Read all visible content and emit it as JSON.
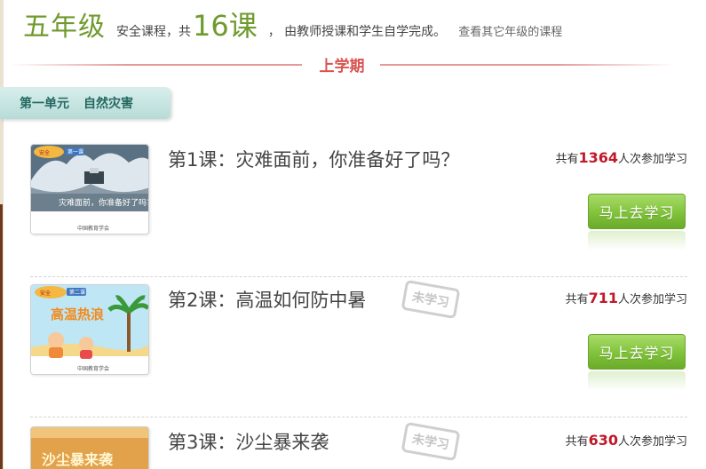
{
  "header": {
    "grade": "五年级",
    "intro": "安全课程，共",
    "count": "16课",
    "intro2": "，  由教师授课和学生自学完成。",
    "other_link": "查看其它年级的课程"
  },
  "semester": {
    "title": "上学期"
  },
  "unit": {
    "label": "第一单元",
    "name": "自然灾害"
  },
  "lessons": [
    {
      "title": "第1课：灾难面前，你准备好了吗？",
      "stats_prefix": "共有",
      "count": "1364",
      "stats_suffix": "人次参加学习",
      "button": "马上去学习",
      "thumb_caption": "灾难面前，你准备好了吗?",
      "thumb_badge": "第一课"
    },
    {
      "title": "第2课：高温如何防中暑",
      "stamp": "未学习",
      "stats_prefix": "共有",
      "count": "711",
      "stats_suffix": "人次参加学习",
      "button": "马上去学习",
      "thumb_caption": "高温热浪",
      "thumb_badge": "第二课"
    },
    {
      "title": "第3课：沙尘暴来袭",
      "stamp": "未学习",
      "stats_prefix": "共有",
      "count": "630",
      "stats_suffix": "人次参加学习",
      "thumb_caption": "沙尘暴来袭"
    }
  ]
}
